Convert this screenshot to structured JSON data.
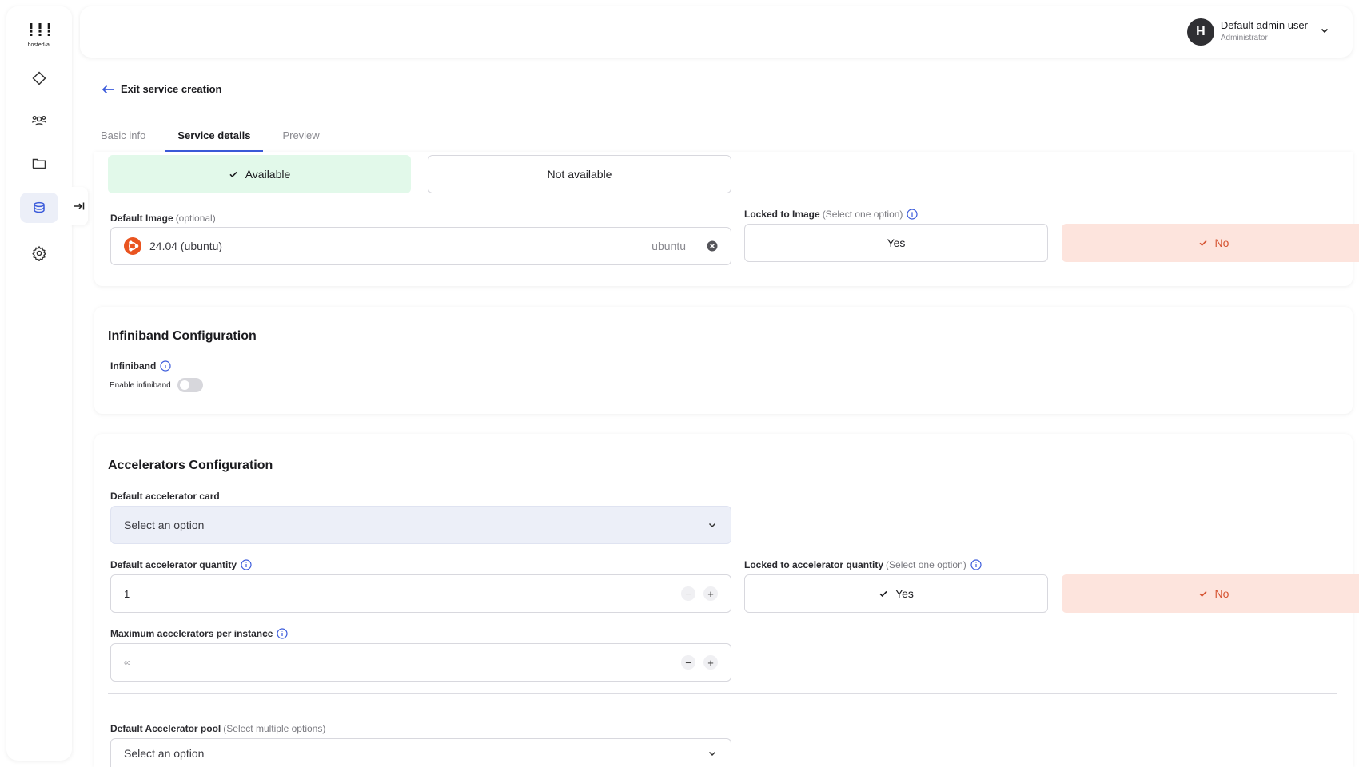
{
  "brand": {
    "logo_text": "hosted·ai",
    "logo_mark": "⁞⁞⁞"
  },
  "user": {
    "initial": "H",
    "name": "Default admin user",
    "role": "Administrator"
  },
  "nav": {
    "back_label": "Exit service creation"
  },
  "tabs": [
    {
      "label": "Basic info"
    },
    {
      "label": "Service details"
    },
    {
      "label": "Preview"
    }
  ],
  "availability": {
    "available_label": "Available",
    "not_available_label": "Not available"
  },
  "image": {
    "label": "Default Image",
    "label_muted": "(optional)",
    "value": "24.04 (ubuntu)",
    "suffix": "ubuntu",
    "locked_label": "Locked to Image",
    "locked_muted": "(Select one option)",
    "yes_label": "Yes",
    "no_label": "No"
  },
  "infiniband": {
    "title": "Infiniband Configuration",
    "label": "Infiniband",
    "toggle_label": "Enable infiniband"
  },
  "accelerators": {
    "title": "Accelerators Configuration",
    "card_label": "Default accelerator card",
    "card_placeholder": "Select an option",
    "quantity_label": "Default accelerator quantity",
    "quantity_value": "1",
    "locked_qty_label": "Locked to accelerator quantity",
    "locked_qty_muted": "(Select one option)",
    "yes_label": "Yes",
    "no_label": "No",
    "max_label": "Maximum accelerators per instance",
    "max_placeholder": "∞",
    "pool_label": "Default Accelerator pool",
    "pool_muted": "(Select multiple options)",
    "pool_placeholder": "Select an option"
  },
  "colors": {
    "accent": "#3b5bdb",
    "available_bg": "#e2f9ea",
    "no_bg": "#fde4dd",
    "no_text": "#d55432",
    "ubuntu": "#e95420"
  }
}
